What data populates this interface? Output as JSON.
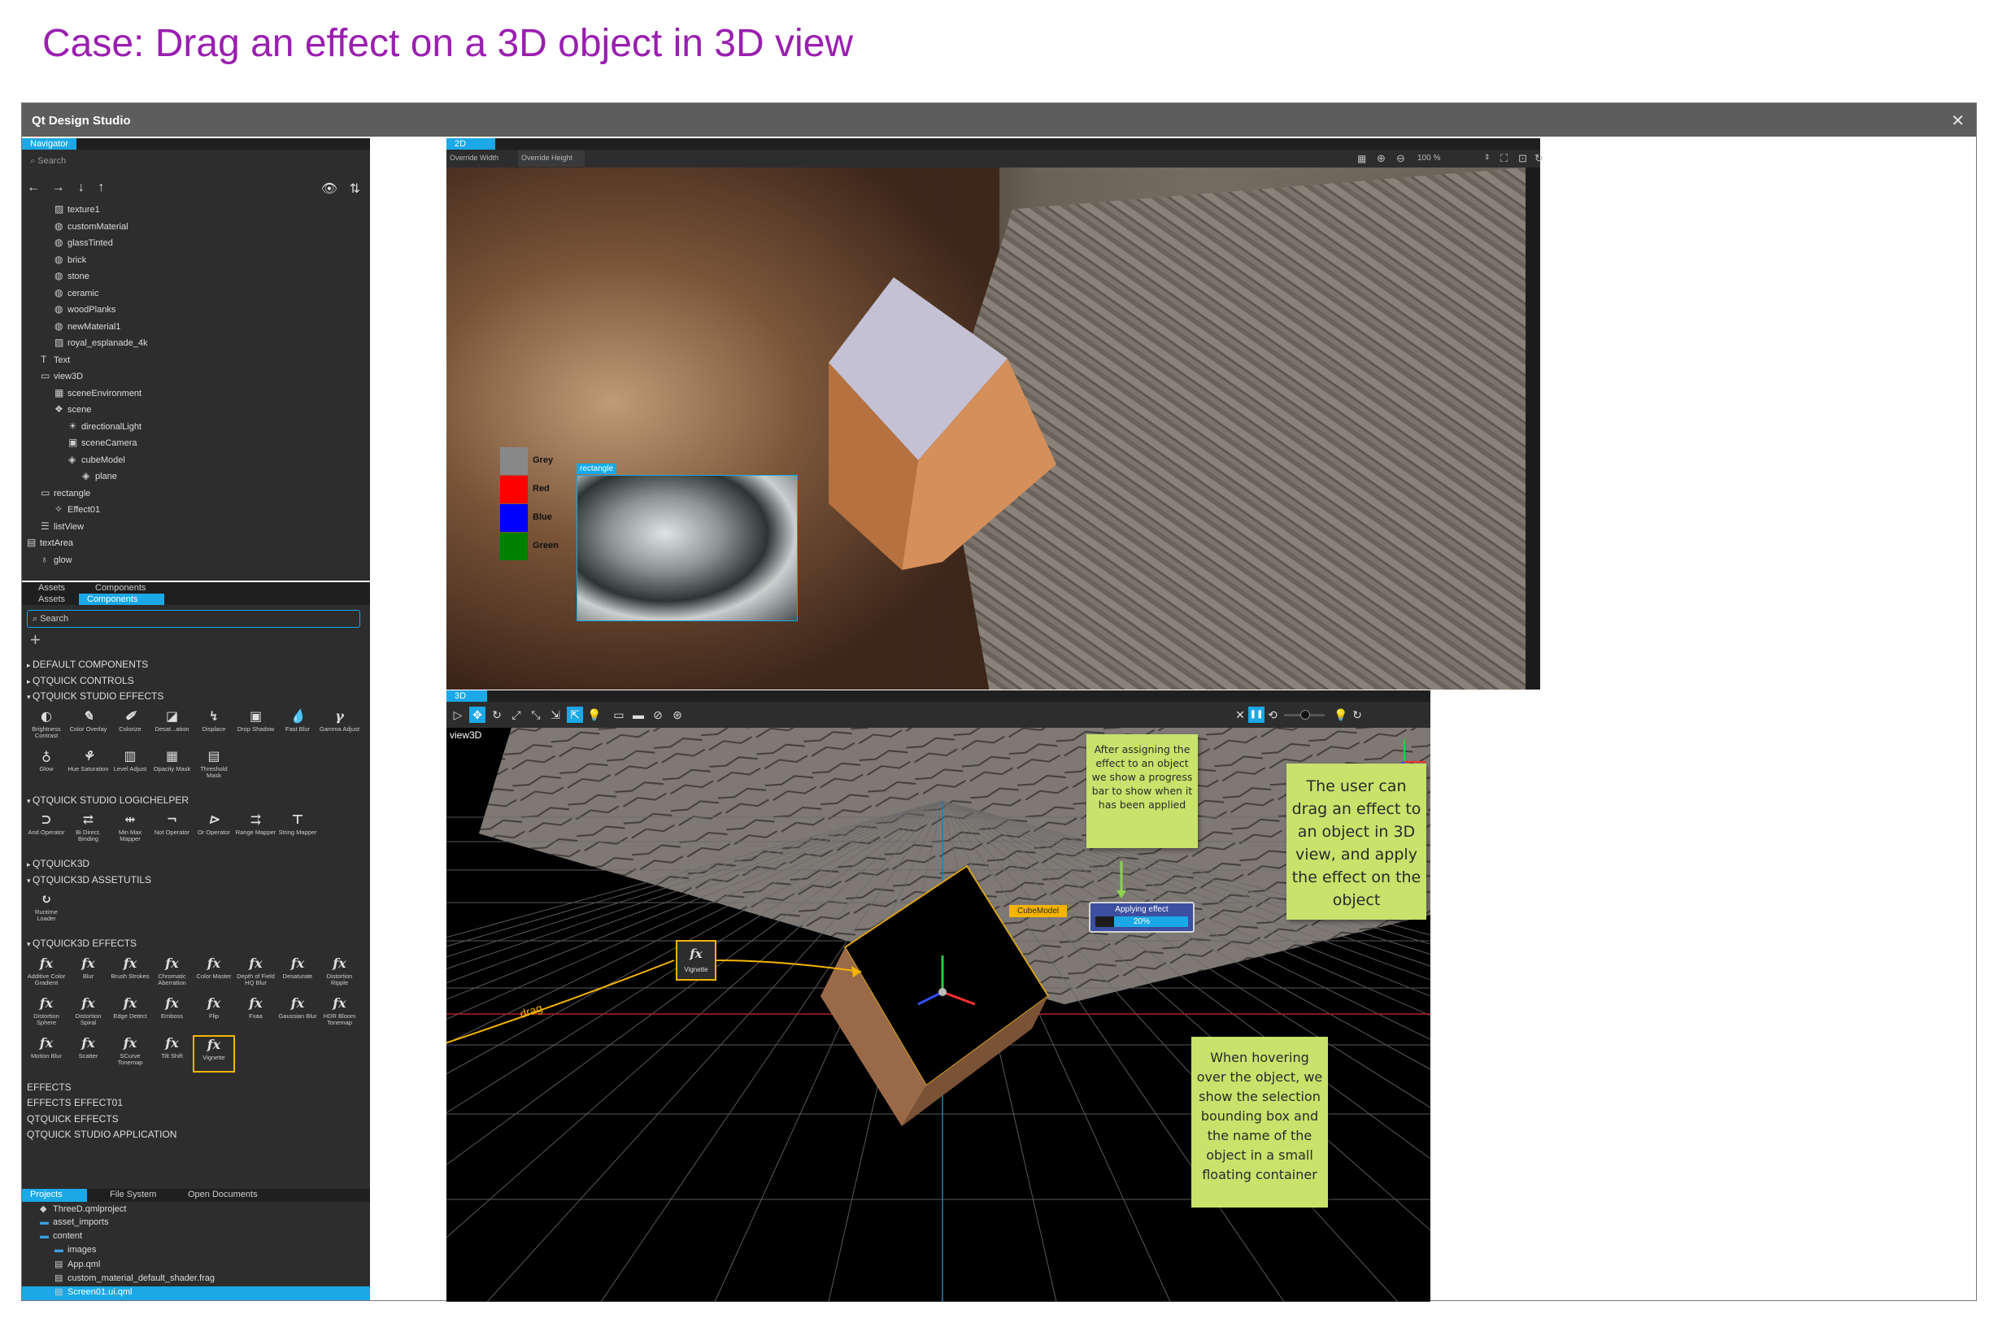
{
  "page": {
    "title": "Case: Drag an effect on a 3D object in 3D view"
  },
  "window": {
    "title": "Qt Design Studio",
    "close": "✕"
  },
  "navigator": {
    "tab": "Navigator",
    "search_placeholder": "Search",
    "arrows": [
      "←",
      "→",
      "↓",
      "↑"
    ],
    "items": [
      {
        "label": "texture1",
        "depth": 2,
        "icon": "image-icon"
      },
      {
        "label": "customMaterial",
        "depth": 2,
        "icon": "material-icon"
      },
      {
        "label": "glassTinted",
        "depth": 2,
        "icon": "material-icon"
      },
      {
        "label": "brick",
        "depth": 2,
        "icon": "material-icon"
      },
      {
        "label": "stone",
        "depth": 2,
        "icon": "material-icon"
      },
      {
        "label": "ceramic",
        "depth": 2,
        "icon": "material-icon"
      },
      {
        "label": "woodPlanks",
        "depth": 2,
        "icon": "material-icon"
      },
      {
        "label": "newMaterial1",
        "depth": 2,
        "icon": "material-icon"
      },
      {
        "label": "royal_esplanade_4k",
        "depth": 2,
        "icon": "image-icon"
      },
      {
        "label": "Text",
        "depth": 1,
        "icon": "text-icon"
      },
      {
        "label": "view3D",
        "depth": 1,
        "icon": "view3d-icon"
      },
      {
        "label": "sceneEnvironment",
        "depth": 2,
        "icon": "environment-icon"
      },
      {
        "label": "scene",
        "depth": 2,
        "icon": "node-icon"
      },
      {
        "label": "directionalLight",
        "depth": 3,
        "icon": "light-icon"
      },
      {
        "label": "sceneCamera",
        "depth": 3,
        "icon": "camera-icon"
      },
      {
        "label": "cubeModel",
        "depth": 3,
        "icon": "model-icon"
      },
      {
        "label": "plane",
        "depth": 4,
        "icon": "model-icon"
      },
      {
        "label": "rectangle",
        "depth": 1,
        "icon": "rectangle-icon"
      },
      {
        "label": "Effect01",
        "depth": 2,
        "icon": "effect-icon"
      },
      {
        "label": "listView",
        "depth": 1,
        "icon": "list-icon"
      },
      {
        "label": "textArea",
        "depth": 0,
        "icon": "text-area-icon"
      },
      {
        "label": "glow",
        "depth": 1,
        "icon": "glow-icon"
      }
    ]
  },
  "library": {
    "tabs_upper": [
      "Assets",
      "Components"
    ],
    "tabs": [
      "Assets",
      "Components"
    ],
    "search_placeholder": "Search",
    "add": "+",
    "sections": [
      {
        "label": "DEFAULT COMPONENTS"
      },
      {
        "label": "QTQUICK CONTROLS"
      },
      {
        "label": "QTQUICK STUDIO EFFECTS",
        "items": [
          "Brightness Contrast",
          "Color Overlay",
          "Colorize",
          "Desat...ation",
          "Displace",
          "Drop Shadow",
          "Fast Blur",
          "Gamma Adjust",
          "Glow",
          "Hue Saturation",
          "Level Adjust",
          "Opacity Mask",
          "Threshold Mask"
        ],
        "glyphs": [
          "◐",
          "✎",
          "✐",
          "◪",
          "↯",
          "▣",
          "💧",
          "γ",
          "♁",
          "⚘",
          "▥",
          "▦",
          "▤"
        ]
      },
      {
        "label": "QTQUICK STUDIO LOGICHELPER",
        "items": [
          "And Operator",
          "Bi Direct. Binding",
          "Min Max Mapper",
          "Not Operator",
          "Or Operator",
          "Range Mapper",
          "String Mapper"
        ],
        "glyphs": [
          "⊃",
          "⇄",
          "⇹",
          "¬",
          "⊳",
          "⇉",
          "⊤"
        ]
      },
      {
        "label": "QTQUICK3D"
      },
      {
        "label": "QTQUICK3D ASSETUTILS",
        "items": [
          "Runtime Loader"
        ],
        "glyphs": [
          "↻"
        ]
      },
      {
        "label": "QTQUICK3D EFFECTS",
        "items": [
          "Additive Color Gradient",
          "Blur",
          "Brush Strokes",
          "Chromatic Aberration",
          "Color Master",
          "Depth of Field HQ Blur",
          "Desaturate",
          "Distortion Ripple",
          "Distortion Sphere",
          "Distortion Spiral",
          "Edge Detect",
          "Emboss",
          "Flip",
          "Fxaa",
          "Gaussian Blur",
          "HDR Bloom Tonemap",
          "Motion Blur",
          "Scatter",
          "SCurve Tonemap",
          "Tilt Shift",
          "Vignette"
        ],
        "glyphs": [
          "fx",
          "fx",
          "fx",
          "fx",
          "fx",
          "fx",
          "fx",
          "fx",
          "fx",
          "fx",
          "fx",
          "fx",
          "fx",
          "fx",
          "fx",
          "fx",
          "fx",
          "fx",
          "fx",
          "fx",
          "fx"
        ]
      },
      {
        "label": "EFFECTS"
      },
      {
        "label": "EFFECTS EFFECT01"
      },
      {
        "label": "QTQUICK EFFECTS"
      },
      {
        "label": "QTQUICK STUDIO APPLICATION"
      }
    ]
  },
  "projects": {
    "tabs": [
      "Projects",
      "File System",
      "Open Documents"
    ],
    "items": [
      {
        "label": "ThreeD.qmlproject",
        "depth": 0,
        "icon": "project-icon"
      },
      {
        "label": "asset_imports",
        "depth": 0,
        "icon": "folder-icon"
      },
      {
        "label": "content",
        "depth": 0,
        "icon": "folder-icon"
      },
      {
        "label": "images",
        "depth": 1,
        "icon": "folder-icon"
      },
      {
        "label": "App.qml",
        "depth": 1,
        "icon": "file-icon"
      },
      {
        "label": "custom_material_default_shader.frag",
        "depth": 1,
        "icon": "file-icon"
      },
      {
        "label": "Screen01.ui.qml",
        "depth": 1,
        "icon": "file-icon",
        "selected": true
      }
    ]
  },
  "view2d": {
    "tab": "2D",
    "override_width": "Override Width",
    "override_height": "Override Height",
    "zoom": "100 %",
    "selection_label": "rectangle",
    "list_items": [
      {
        "label": "Grey",
        "color": "#888888"
      },
      {
        "label": "Red",
        "color": "#ff0000"
      },
      {
        "label": "Blue",
        "color": "#0000ff"
      },
      {
        "label": "Green",
        "color": "#008000"
      }
    ]
  },
  "view3d": {
    "tab": "3D",
    "view_label": "view3D",
    "drag_label": "drag",
    "effect_chip": "Vignette",
    "object_tag": "CubeModel",
    "progress_title": "Applying effect",
    "progress_percent": 0.2,
    "progress_text": "20%"
  },
  "notes": {
    "progress": "After assigning the effect to an object we show a progress bar to show when it has been applied",
    "drag": "The user can drag an effect to an object in 3D view, and apply the effect on the object",
    "hover": "When hovering over the object, we show the selection bounding box and the name of the object in a small floating container"
  },
  "colors": {
    "accent": "#1aa8e6",
    "highlight": "#f5b400",
    "note": "#c8e26b",
    "title": "#9a1fb0"
  }
}
